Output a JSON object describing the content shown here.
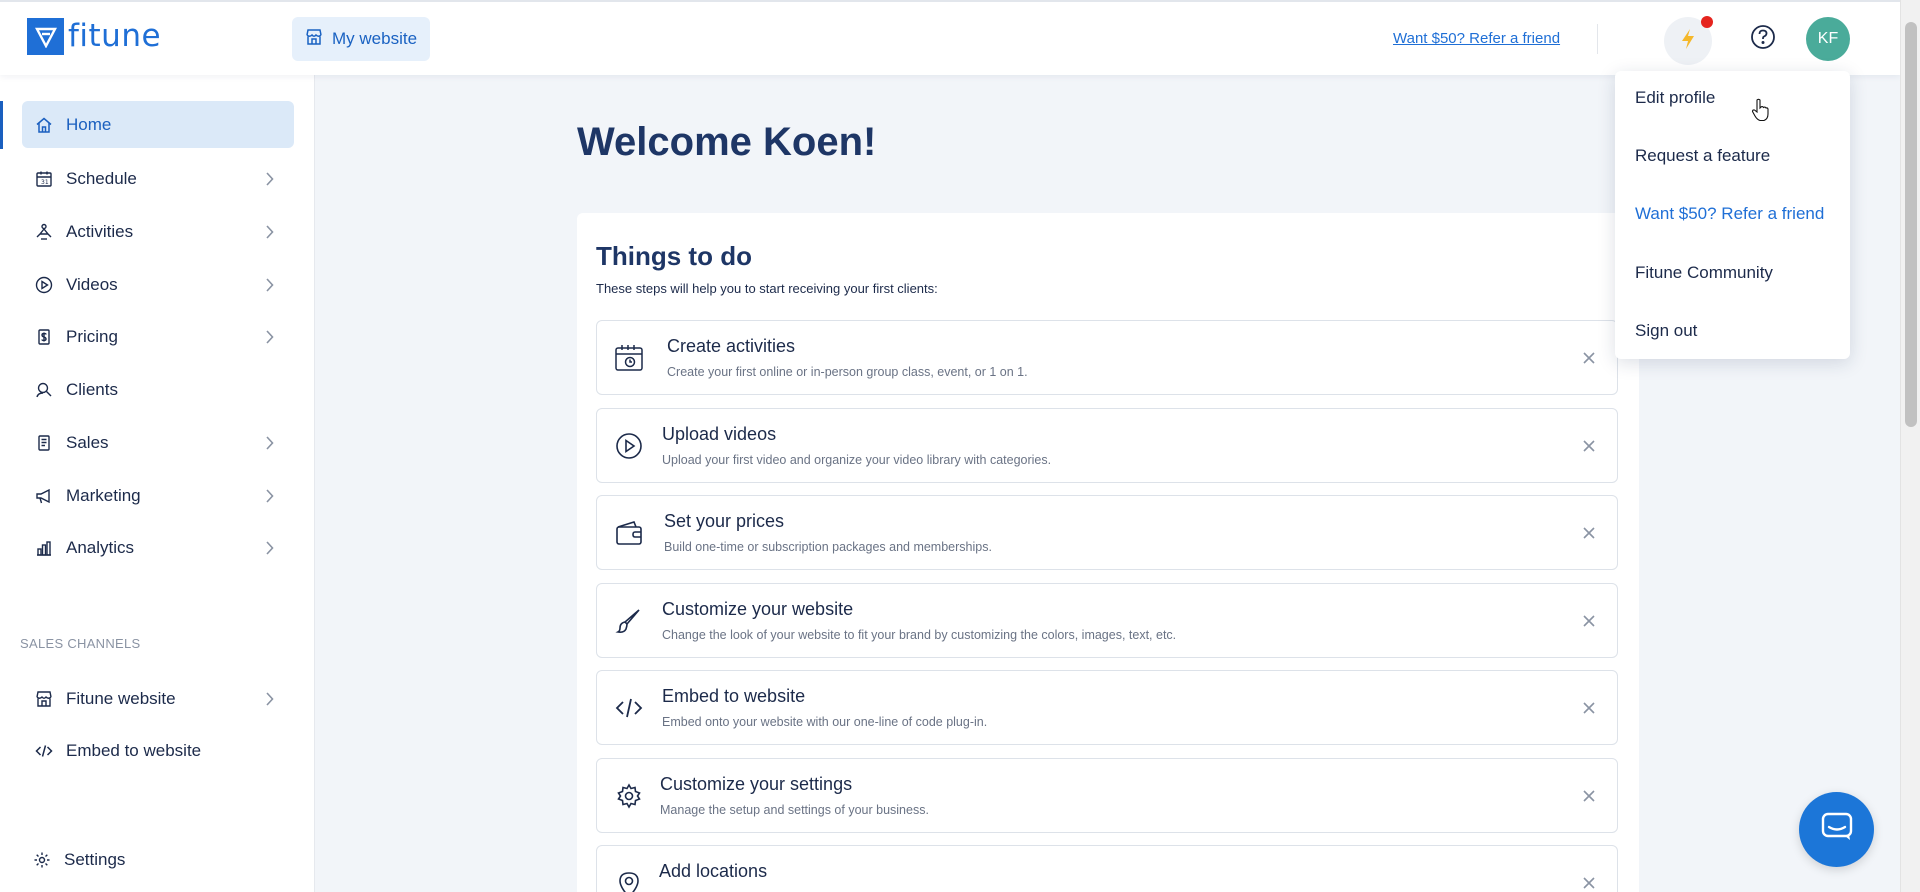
{
  "brand": {
    "name": "fitune",
    "accent": "#1f6fd6"
  },
  "header": {
    "site_button": "My website",
    "refer_link": "Want $50? Refer a friend",
    "avatar_initials": "KF",
    "notification_color": "#e5241e",
    "avatar_color": "#4aab9a"
  },
  "sidebar": {
    "items": [
      {
        "label": "Home",
        "icon": "home-icon",
        "chevron": false
      },
      {
        "label": "Schedule",
        "icon": "calendar-icon",
        "chevron": true
      },
      {
        "label": "Activities",
        "icon": "activities-icon",
        "chevron": true
      },
      {
        "label": "Videos",
        "icon": "play-icon",
        "chevron": true
      },
      {
        "label": "Pricing",
        "icon": "price-tag-icon",
        "chevron": true
      },
      {
        "label": "Clients",
        "icon": "clients-icon",
        "chevron": false
      },
      {
        "label": "Sales",
        "icon": "receipt-icon",
        "chevron": true
      },
      {
        "label": "Marketing",
        "icon": "megaphone-icon",
        "chevron": true
      },
      {
        "label": "Analytics",
        "icon": "analytics-icon",
        "chevron": true
      }
    ],
    "section_label": "SALES CHANNELS",
    "channels": [
      {
        "label": "Fitune website",
        "icon": "storefront-icon",
        "chevron": true
      },
      {
        "label": "Embed to website",
        "icon": "code-icon",
        "chevron": false
      }
    ],
    "settings_label": "Settings"
  },
  "main": {
    "welcome": "Welcome Koen!",
    "todo_title": "Things to do",
    "todo_subtitle": "These steps will help you to start receiving your first clients:",
    "tasks": [
      {
        "title": "Create activities",
        "desc": "Create your first online or in-person group class, event, or 1 on 1.",
        "icon": "calendar-clock-icon"
      },
      {
        "title": "Upload videos",
        "desc": "Upload your first video and organize your video library with categories.",
        "icon": "play-circle-icon"
      },
      {
        "title": "Set your prices",
        "desc": "Build one-time or subscription packages and memberships.",
        "icon": "wallet-icon"
      },
      {
        "title": "Customize your website",
        "desc": "Change the look of your website to fit your brand by customizing the colors, images, text, etc.",
        "icon": "brush-icon"
      },
      {
        "title": "Embed to website",
        "desc": "Embed onto your website with our one-line of code plug-in.",
        "icon": "code-icon"
      },
      {
        "title": "Customize your settings",
        "desc": "Manage the setup and settings of your business.",
        "icon": "gear-icon"
      },
      {
        "title": "Add locations",
        "desc": "",
        "icon": "location-pin-icon"
      }
    ]
  },
  "profile_menu": {
    "items": [
      {
        "label": "Edit profile"
      },
      {
        "label": "Request a feature"
      },
      {
        "label": "Want $50? Refer a friend"
      },
      {
        "label": "Fitune Community"
      },
      {
        "label": "Sign out"
      }
    ]
  }
}
